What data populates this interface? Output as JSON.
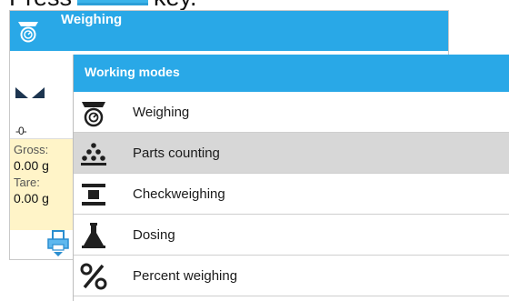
{
  "instruction": {
    "before": "Press",
    "after": "key."
  },
  "background_screen": {
    "header_title": "Weighing",
    "header_icon": "scale-icon",
    "zero_indicator": "-0-",
    "gross_label": "Gross:",
    "gross_value": "0.00 g",
    "tare_label": "Tare:",
    "tare_value": "0.00 g",
    "print_icon": "printer-icon",
    "stability_icon": "stable-icon"
  },
  "working_modes": {
    "title": "Working modes",
    "items": [
      {
        "label": "Weighing",
        "icon": "weighing-icon",
        "selected": false
      },
      {
        "label": "Parts counting",
        "icon": "parts-counting-icon",
        "selected": true
      },
      {
        "label": "Checkweighing",
        "icon": "checkweighing-icon",
        "selected": false
      },
      {
        "label": "Dosing",
        "icon": "dosing-icon",
        "selected": false
      },
      {
        "label": "Percent weighing",
        "icon": "percent-weighing-icon",
        "selected": false
      }
    ]
  },
  "colors": {
    "header_blue": "#29a8e7",
    "selected_row": "#d7d7d7",
    "info_panel": "#fff4c8"
  }
}
